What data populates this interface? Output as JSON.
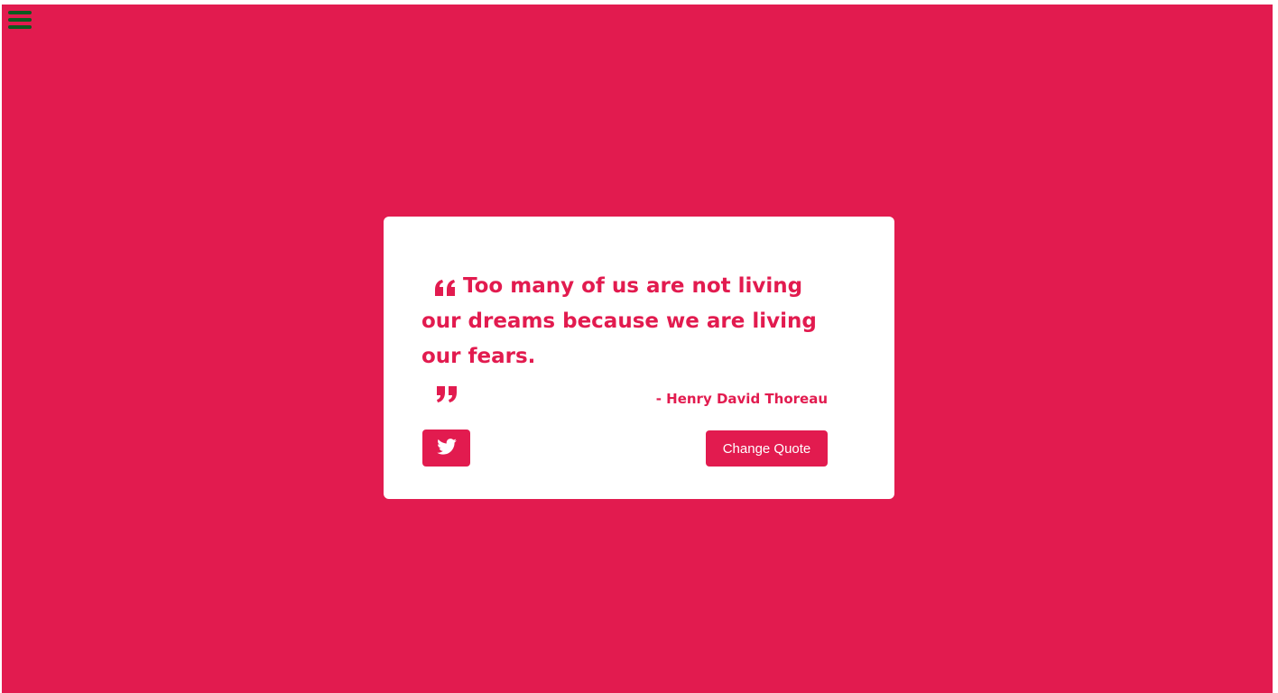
{
  "menu": {
    "icon": "hamburger-menu-icon"
  },
  "quote": {
    "open_icon": "quote-left-icon",
    "text": "Too many of us are not living our dreams because we are living our fears.",
    "close_icon": "quote-right-icon"
  },
  "author": "- Henry David Thoreau",
  "actions": {
    "tweet_icon": "twitter-icon",
    "change_label": "Change Quote"
  },
  "colors": {
    "accent": "#e21b4f",
    "menu_icon": "#0b5a1f",
    "card": "#ffffff"
  }
}
